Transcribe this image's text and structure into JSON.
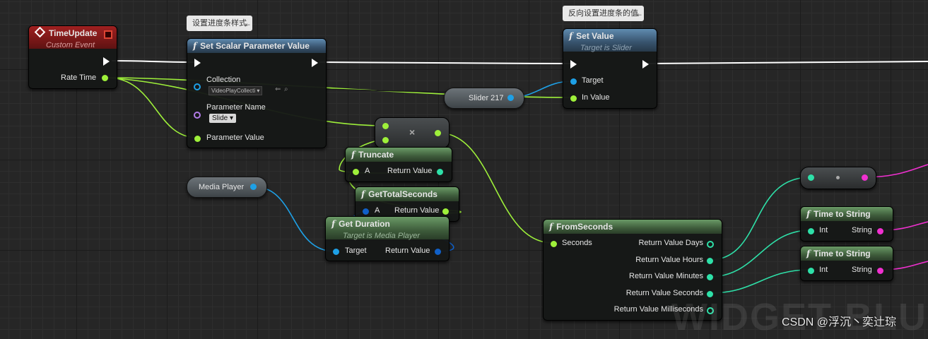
{
  "comments": {
    "set_progress_style": "设置进度条样式",
    "set_reverse_value": "反向设置进度条的值"
  },
  "event_node": {
    "title": "TimeUpdate",
    "subtitle": "Custom Event",
    "pin_rate_time": "Rate Time"
  },
  "set_scalar": {
    "title": "Set Scalar Parameter Value",
    "pin_collection": "Collection",
    "collection_value": "VideoPlayCollecti",
    "pin_parameter_name": "Parameter Name",
    "parameter_name_value": "Slide",
    "pin_parameter_value": "Parameter Value"
  },
  "slider_var": {
    "label": "Slider 217"
  },
  "set_value": {
    "title": "Set Value",
    "subtitle": "Target is Slider",
    "pin_target": "Target",
    "pin_in_value": "In Value"
  },
  "multiply": {
    "symbol": "×"
  },
  "truncate": {
    "title": "Truncate",
    "pin_a": "A",
    "pin_return": "Return Value"
  },
  "get_total_seconds": {
    "title": "GetTotalSeconds",
    "pin_a": "A",
    "pin_return": "Return Value"
  },
  "get_duration": {
    "title": "Get Duration",
    "subtitle": "Target is Media Player",
    "pin_target": "Target",
    "pin_return": "Return Value"
  },
  "media_player_var": {
    "label": "Media  Player"
  },
  "from_seconds": {
    "title": "FromSeconds",
    "pin_seconds": "Seconds",
    "pin_days": "Return Value Days",
    "pin_hours": "Return Value Hours",
    "pin_minutes": "Return Value Minutes",
    "pin_seconds_out": "Return Value Seconds",
    "pin_ms": "Return Value Milliseconds"
  },
  "time_to_string_1": {
    "title": "Time to String",
    "pin_int": "Int",
    "pin_string": "String"
  },
  "time_to_string_2": {
    "title": "Time to String",
    "pin_int": "Int",
    "pin_string": "String"
  },
  "watermark": "WIDGET BLUEP",
  "credit": "CSDN @浮沉丶奕辻琮",
  "colors": {
    "exec": "#ffffff",
    "float": "#9ef03a",
    "int": "#2ee0a8",
    "object": "#1ea0e6",
    "name": "#b27ce8",
    "string": "#f030d0"
  }
}
